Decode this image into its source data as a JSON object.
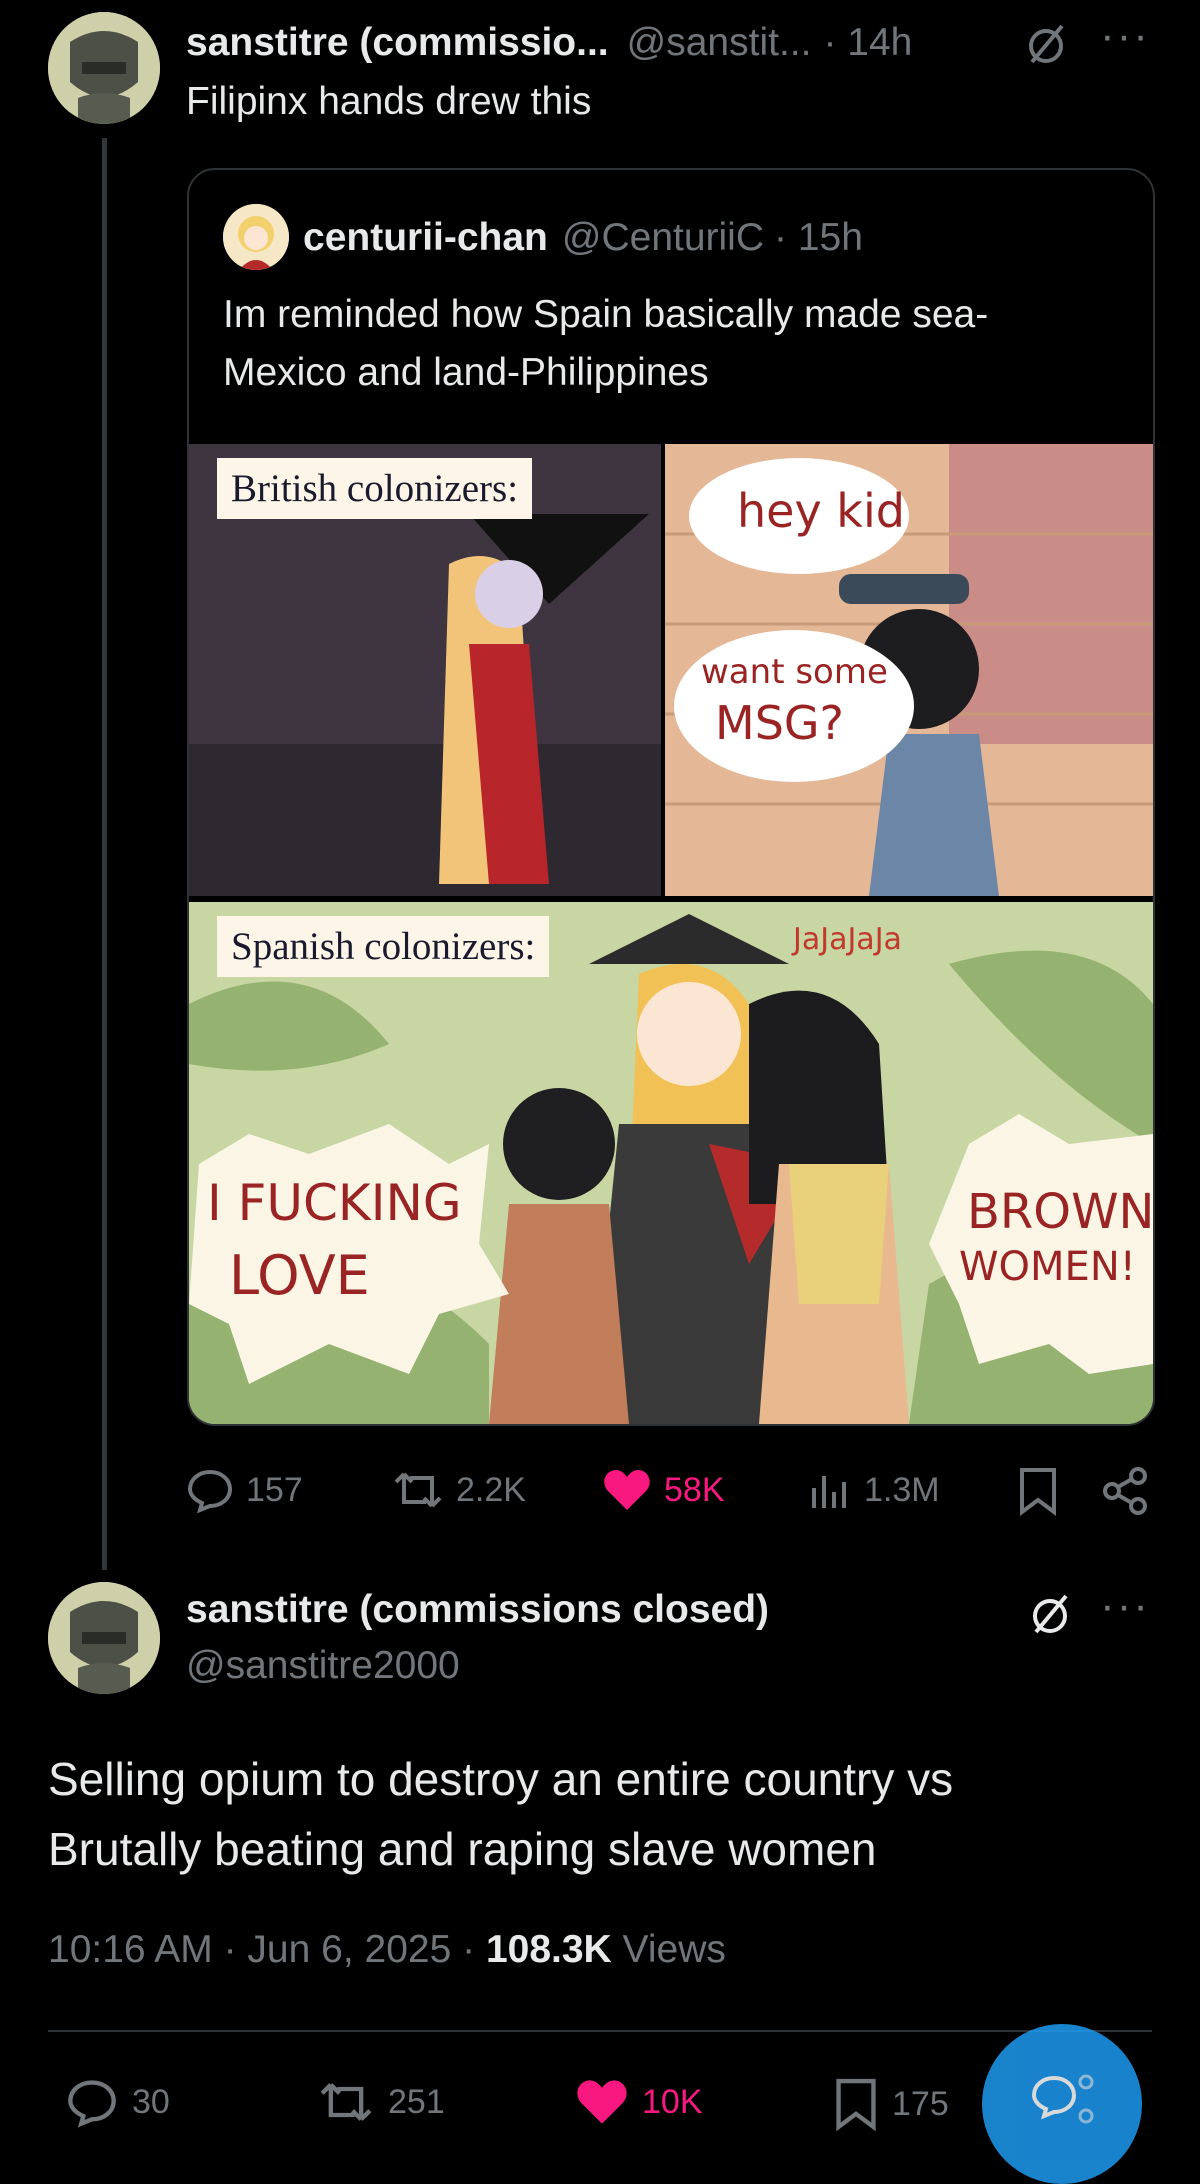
{
  "top_post": {
    "author_name": "sanstitre (commissio...",
    "handle": "@sanstit...",
    "time": "· 14h",
    "text": "Filipinx hands drew this"
  },
  "quoted_post": {
    "author_name": "centurii-chan",
    "handle": "@CenturiiC",
    "time": "· 15h",
    "text": "Im reminded how Spain basically made sea-Mexico and land-Philippines",
    "comic": {
      "panel1_caption": "British colonizers:",
      "bubble1": "hey kid",
      "bubble2_line1": "want some",
      "bubble2_line2": "MSG?",
      "panel2_caption": "Spanish colonizers:",
      "laugh": "JaJaJaJa",
      "shout_left_line1": "I FUCKING",
      "shout_left_line2": "LOVE",
      "shout_right_line1": "BROWN",
      "shout_right_line2": "WOMEN!"
    }
  },
  "top_post_stats": {
    "replies": "157",
    "reposts": "2.2K",
    "likes": "58K",
    "views": "1.3M"
  },
  "main_post": {
    "author_name": "sanstitre (commissions closed)",
    "handle": "@sanstitre2000",
    "text_line1": "Selling opium to destroy an entire country vs",
    "text_line2": "Brutally beating and raping slave women",
    "time": "10:16 AM · Jun 6, 2025 · ",
    "views_count": "108.3K",
    "views_label": " Views"
  },
  "main_post_stats": {
    "replies": "30",
    "reposts": "251",
    "likes": "10K",
    "bookmarks": "175"
  },
  "colors": {
    "background": "#000000",
    "text": "#e7e9ea",
    "muted": "#71767b",
    "like": "#f91880",
    "fab": "#1d9bf0"
  }
}
